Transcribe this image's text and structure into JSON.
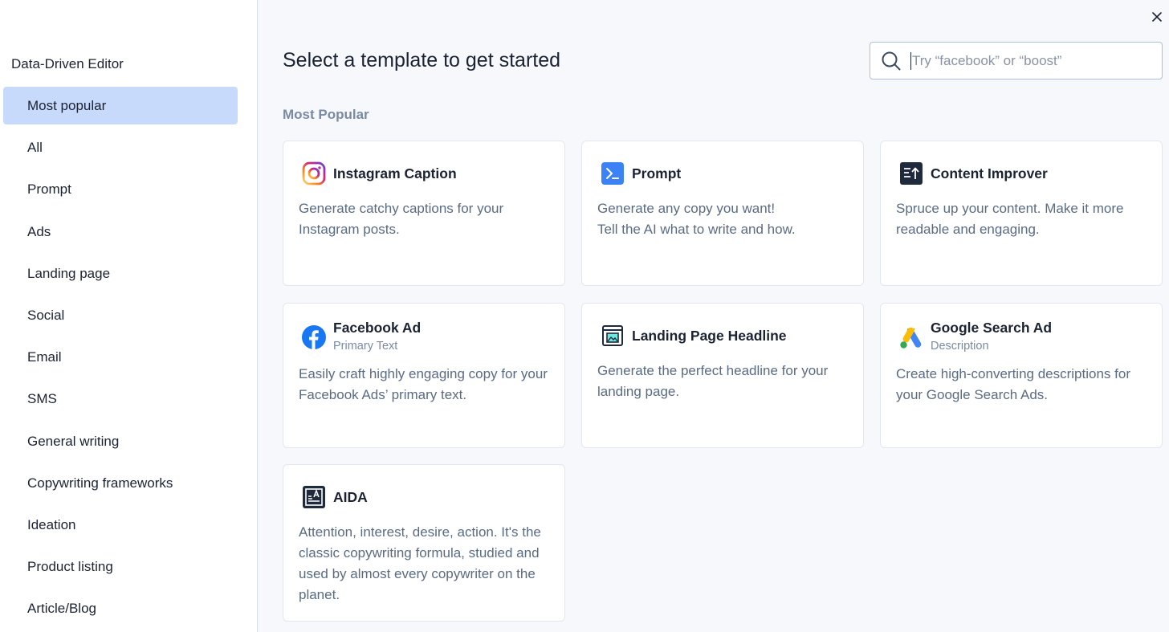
{
  "sidebar": {
    "title": "Data-Driven Editor",
    "items": [
      {
        "label": "Most popular",
        "active": true
      },
      {
        "label": "All"
      },
      {
        "label": "Prompt"
      },
      {
        "label": "Ads"
      },
      {
        "label": "Landing page"
      },
      {
        "label": "Social"
      },
      {
        "label": "Email"
      },
      {
        "label": "SMS"
      },
      {
        "label": "General writing"
      },
      {
        "label": "Copywriting frameworks"
      },
      {
        "label": "Ideation"
      },
      {
        "label": "Product listing"
      },
      {
        "label": "Article/Blog"
      }
    ]
  },
  "header": {
    "title": "Select a template to get started",
    "close_icon": "close-icon"
  },
  "search": {
    "placeholder": "Try “facebook” or “boost”",
    "value": "",
    "icon": "search-icon"
  },
  "main": {
    "section_label": "Most Popular",
    "cards": [
      {
        "title": "Instagram Caption",
        "subtitle": "",
        "description": "Generate catchy captions for your Instagram posts.",
        "icon": "instagram-icon"
      },
      {
        "title": "Prompt",
        "subtitle": "",
        "description": "Generate any copy you want!\nTell the AI what to write and how.",
        "icon": "prompt-icon"
      },
      {
        "title": "Content Improver",
        "subtitle": "",
        "description": "Spruce up your content. Make it more readable and engaging.",
        "icon": "content-improver-icon"
      },
      {
        "title": "Facebook Ad",
        "subtitle": "Primary Text",
        "description": "Easily craft highly engaging copy for your Facebook Ads’ primary text.",
        "icon": "facebook-icon"
      },
      {
        "title": "Landing Page Headline",
        "subtitle": "",
        "description": "Generate the perfect headline for your landing page.",
        "icon": "landing-page-icon"
      },
      {
        "title": "Google Search Ad",
        "subtitle": "Description",
        "description": "Create high-converting descriptions for your Google Search Ads.",
        "icon": "google-ads-icon"
      },
      {
        "title": "AIDA",
        "subtitle": "",
        "description": "Attention, interest, desire, action. It's the classic copywriting formula, studied and used by almost every copywriter on the planet.",
        "icon": "aida-icon"
      }
    ]
  },
  "colors": {
    "active_item_bg": "#c8dafc",
    "background": "#f6f8fc",
    "prompt_blue": "#3b82f6",
    "facebook_blue": "#1877f2"
  }
}
